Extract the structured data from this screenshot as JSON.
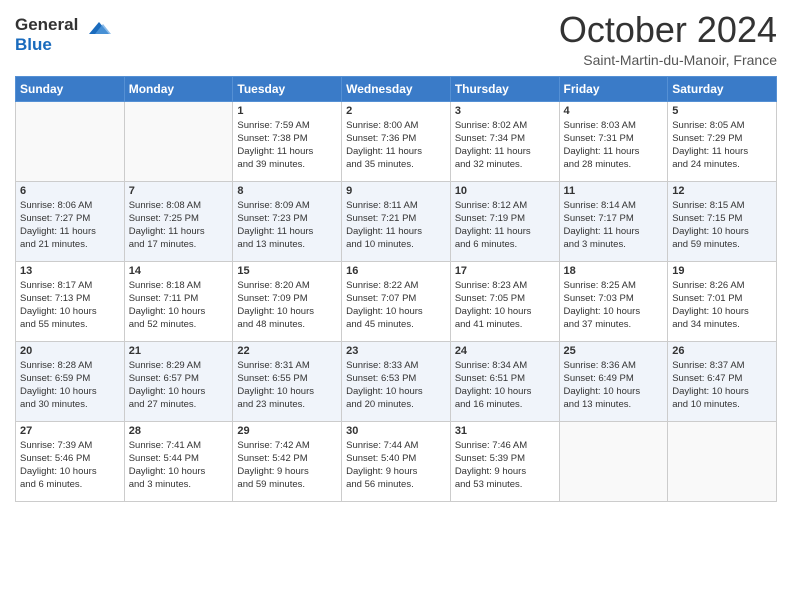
{
  "header": {
    "logo": {
      "line1": "General",
      "line2": "Blue"
    },
    "title": "October 2024",
    "location": "Saint-Martin-du-Manoir, France"
  },
  "days_of_week": [
    "Sunday",
    "Monday",
    "Tuesday",
    "Wednesday",
    "Thursday",
    "Friday",
    "Saturday"
  ],
  "weeks": [
    [
      {
        "day": "",
        "info": ""
      },
      {
        "day": "",
        "info": ""
      },
      {
        "day": "1",
        "info": "Sunrise: 7:59 AM\nSunset: 7:38 PM\nDaylight: 11 hours\nand 39 minutes."
      },
      {
        "day": "2",
        "info": "Sunrise: 8:00 AM\nSunset: 7:36 PM\nDaylight: 11 hours\nand 35 minutes."
      },
      {
        "day": "3",
        "info": "Sunrise: 8:02 AM\nSunset: 7:34 PM\nDaylight: 11 hours\nand 32 minutes."
      },
      {
        "day": "4",
        "info": "Sunrise: 8:03 AM\nSunset: 7:31 PM\nDaylight: 11 hours\nand 28 minutes."
      },
      {
        "day": "5",
        "info": "Sunrise: 8:05 AM\nSunset: 7:29 PM\nDaylight: 11 hours\nand 24 minutes."
      }
    ],
    [
      {
        "day": "6",
        "info": "Sunrise: 8:06 AM\nSunset: 7:27 PM\nDaylight: 11 hours\nand 21 minutes."
      },
      {
        "day": "7",
        "info": "Sunrise: 8:08 AM\nSunset: 7:25 PM\nDaylight: 11 hours\nand 17 minutes."
      },
      {
        "day": "8",
        "info": "Sunrise: 8:09 AM\nSunset: 7:23 PM\nDaylight: 11 hours\nand 13 minutes."
      },
      {
        "day": "9",
        "info": "Sunrise: 8:11 AM\nSunset: 7:21 PM\nDaylight: 11 hours\nand 10 minutes."
      },
      {
        "day": "10",
        "info": "Sunrise: 8:12 AM\nSunset: 7:19 PM\nDaylight: 11 hours\nand 6 minutes."
      },
      {
        "day": "11",
        "info": "Sunrise: 8:14 AM\nSunset: 7:17 PM\nDaylight: 11 hours\nand 3 minutes."
      },
      {
        "day": "12",
        "info": "Sunrise: 8:15 AM\nSunset: 7:15 PM\nDaylight: 10 hours\nand 59 minutes."
      }
    ],
    [
      {
        "day": "13",
        "info": "Sunrise: 8:17 AM\nSunset: 7:13 PM\nDaylight: 10 hours\nand 55 minutes."
      },
      {
        "day": "14",
        "info": "Sunrise: 8:18 AM\nSunset: 7:11 PM\nDaylight: 10 hours\nand 52 minutes."
      },
      {
        "day": "15",
        "info": "Sunrise: 8:20 AM\nSunset: 7:09 PM\nDaylight: 10 hours\nand 48 minutes."
      },
      {
        "day": "16",
        "info": "Sunrise: 8:22 AM\nSunset: 7:07 PM\nDaylight: 10 hours\nand 45 minutes."
      },
      {
        "day": "17",
        "info": "Sunrise: 8:23 AM\nSunset: 7:05 PM\nDaylight: 10 hours\nand 41 minutes."
      },
      {
        "day": "18",
        "info": "Sunrise: 8:25 AM\nSunset: 7:03 PM\nDaylight: 10 hours\nand 37 minutes."
      },
      {
        "day": "19",
        "info": "Sunrise: 8:26 AM\nSunset: 7:01 PM\nDaylight: 10 hours\nand 34 minutes."
      }
    ],
    [
      {
        "day": "20",
        "info": "Sunrise: 8:28 AM\nSunset: 6:59 PM\nDaylight: 10 hours\nand 30 minutes."
      },
      {
        "day": "21",
        "info": "Sunrise: 8:29 AM\nSunset: 6:57 PM\nDaylight: 10 hours\nand 27 minutes."
      },
      {
        "day": "22",
        "info": "Sunrise: 8:31 AM\nSunset: 6:55 PM\nDaylight: 10 hours\nand 23 minutes."
      },
      {
        "day": "23",
        "info": "Sunrise: 8:33 AM\nSunset: 6:53 PM\nDaylight: 10 hours\nand 20 minutes."
      },
      {
        "day": "24",
        "info": "Sunrise: 8:34 AM\nSunset: 6:51 PM\nDaylight: 10 hours\nand 16 minutes."
      },
      {
        "day": "25",
        "info": "Sunrise: 8:36 AM\nSunset: 6:49 PM\nDaylight: 10 hours\nand 13 minutes."
      },
      {
        "day": "26",
        "info": "Sunrise: 8:37 AM\nSunset: 6:47 PM\nDaylight: 10 hours\nand 10 minutes."
      }
    ],
    [
      {
        "day": "27",
        "info": "Sunrise: 7:39 AM\nSunset: 5:46 PM\nDaylight: 10 hours\nand 6 minutes."
      },
      {
        "day": "28",
        "info": "Sunrise: 7:41 AM\nSunset: 5:44 PM\nDaylight: 10 hours\nand 3 minutes."
      },
      {
        "day": "29",
        "info": "Sunrise: 7:42 AM\nSunset: 5:42 PM\nDaylight: 9 hours\nand 59 minutes."
      },
      {
        "day": "30",
        "info": "Sunrise: 7:44 AM\nSunset: 5:40 PM\nDaylight: 9 hours\nand 56 minutes."
      },
      {
        "day": "31",
        "info": "Sunrise: 7:46 AM\nSunset: 5:39 PM\nDaylight: 9 hours\nand 53 minutes."
      },
      {
        "day": "",
        "info": ""
      },
      {
        "day": "",
        "info": ""
      }
    ]
  ]
}
